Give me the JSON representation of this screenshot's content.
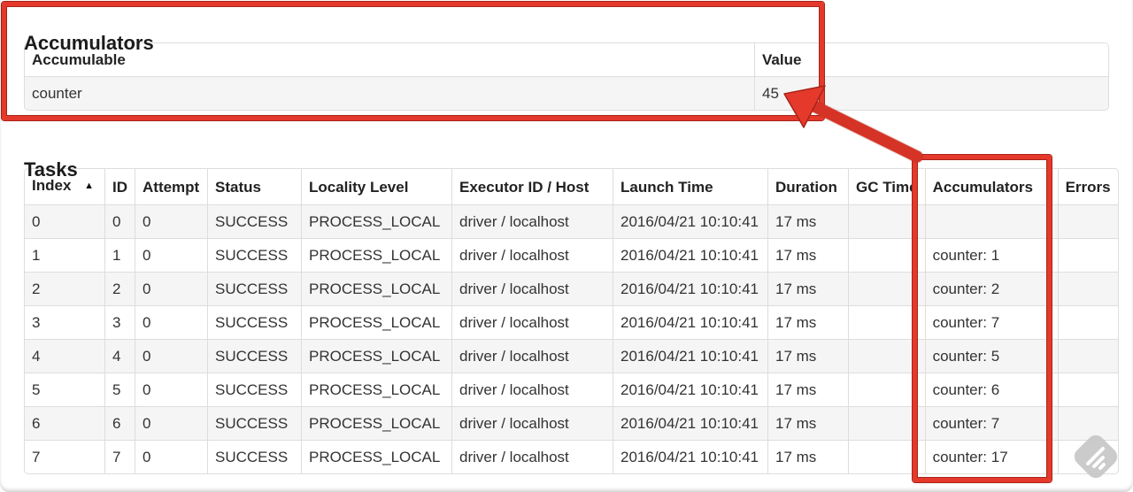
{
  "colors": {
    "annotation_red": "#e4392b",
    "annotation_red_dark": "#a82418",
    "table_border": "#dddddd",
    "row_stripe": "#f5f5f5",
    "text": "#333333"
  },
  "icons": {
    "sort_ascending": "▲",
    "watermark": "feedly-style-diamond"
  },
  "accumulators_section": {
    "heading": "Accumulators",
    "table": {
      "columns": [
        "Accumulable",
        "Value"
      ],
      "rows": [
        {
          "accumulable": "counter",
          "value": "45"
        }
      ]
    }
  },
  "tasks_section": {
    "heading": "Tasks",
    "table": {
      "columns": [
        "Index",
        "ID",
        "Attempt",
        "Status",
        "Locality Level",
        "Executor ID / Host",
        "Launch Time",
        "Duration",
        "GC Time",
        "Accumulators",
        "Errors"
      ],
      "sort": {
        "column": "Index",
        "direction_icon": "▲"
      },
      "rows": [
        {
          "index": "0",
          "id": "0",
          "attempt": "0",
          "status": "SUCCESS",
          "locality_level": "PROCESS_LOCAL",
          "executor_id_host": "driver / localhost",
          "launch_time": "2016/04/21 10:10:41",
          "duration": "17 ms",
          "gc_time": "",
          "accumulators": "",
          "errors": ""
        },
        {
          "index": "1",
          "id": "1",
          "attempt": "0",
          "status": "SUCCESS",
          "locality_level": "PROCESS_LOCAL",
          "executor_id_host": "driver / localhost",
          "launch_time": "2016/04/21 10:10:41",
          "duration": "17 ms",
          "gc_time": "",
          "accumulators": "counter: 1",
          "errors": ""
        },
        {
          "index": "2",
          "id": "2",
          "attempt": "0",
          "status": "SUCCESS",
          "locality_level": "PROCESS_LOCAL",
          "executor_id_host": "driver / localhost",
          "launch_time": "2016/04/21 10:10:41",
          "duration": "17 ms",
          "gc_time": "",
          "accumulators": "counter: 2",
          "errors": ""
        },
        {
          "index": "3",
          "id": "3",
          "attempt": "0",
          "status": "SUCCESS",
          "locality_level": "PROCESS_LOCAL",
          "executor_id_host": "driver / localhost",
          "launch_time": "2016/04/21 10:10:41",
          "duration": "17 ms",
          "gc_time": "",
          "accumulators": "counter: 7",
          "errors": ""
        },
        {
          "index": "4",
          "id": "4",
          "attempt": "0",
          "status": "SUCCESS",
          "locality_level": "PROCESS_LOCAL",
          "executor_id_host": "driver / localhost",
          "launch_time": "2016/04/21 10:10:41",
          "duration": "17 ms",
          "gc_time": "",
          "accumulators": "counter: 5",
          "errors": ""
        },
        {
          "index": "5",
          "id": "5",
          "attempt": "0",
          "status": "SUCCESS",
          "locality_level": "PROCESS_LOCAL",
          "executor_id_host": "driver / localhost",
          "launch_time": "2016/04/21 10:10:41",
          "duration": "17 ms",
          "gc_time": "",
          "accumulators": "counter: 6",
          "errors": ""
        },
        {
          "index": "6",
          "id": "6",
          "attempt": "0",
          "status": "SUCCESS",
          "locality_level": "PROCESS_LOCAL",
          "executor_id_host": "driver / localhost",
          "launch_time": "2016/04/21 10:10:41",
          "duration": "17 ms",
          "gc_time": "",
          "accumulators": "counter: 7",
          "errors": ""
        },
        {
          "index": "7",
          "id": "7",
          "attempt": "0",
          "status": "SUCCESS",
          "locality_level": "PROCESS_LOCAL",
          "executor_id_host": "driver / localhost",
          "launch_time": "2016/04/21 10:10:41",
          "duration": "17 ms",
          "gc_time": "",
          "accumulators": "counter: 17",
          "errors": ""
        }
      ]
    }
  }
}
